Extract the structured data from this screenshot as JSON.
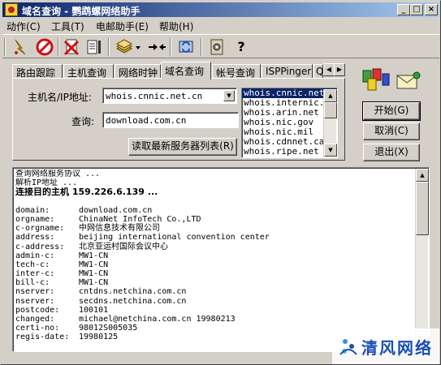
{
  "window": {
    "title": "域名查询 - 鹦鹉螺网络助手",
    "controls": [
      "_",
      "□",
      "×"
    ]
  },
  "menu": [
    {
      "label": "动作(C)"
    },
    {
      "label": "工具(T)"
    },
    {
      "label": "电邮助手(E)"
    },
    {
      "label": "帮助(H)"
    }
  ],
  "toolbar": {
    "icons": [
      "lightning-icon",
      "stop-icon",
      "delete-icon",
      "export-icon",
      "database-icon",
      "dropdown-arrow-icon",
      "connect-icon",
      "refresh-icon",
      "settings-icon",
      "help-icon"
    ],
    "help_label": "?"
  },
  "tabs": [
    {
      "label": "路由跟踪",
      "active": false
    },
    {
      "label": "主机查询",
      "active": false
    },
    {
      "label": "网络时钟",
      "active": false
    },
    {
      "label": "域名查询",
      "active": true
    },
    {
      "label": "帐号查询",
      "active": false
    },
    {
      "label": "ISPPinger",
      "active": false
    },
    {
      "label": "Q",
      "active": false
    }
  ],
  "form": {
    "host_label": "主机名/IP地址:",
    "host_value": "whois.cnnic.net.cn",
    "query_label": "查询:",
    "query_value": "download.com.cn",
    "read_servers_button": "读取最新服务器列表(R)"
  },
  "server_list": {
    "items": [
      "whois.cnnic.net",
      "whois.internic.n",
      "whois.arin.net",
      "whois.nic.gov",
      "whois.nic.mil",
      "whois.cdnnet.ca",
      "whois.ripe.net"
    ],
    "selected_index": 0
  },
  "buttons": {
    "start": "开始(G)",
    "cancel": "取消(C)",
    "exit": "退出(X)"
  },
  "output": {
    "status_lines": [
      {
        "text": "查询网络服务协议 ...",
        "bold": false
      },
      {
        "text": "解析IP地址 ...",
        "bold": false
      },
      {
        "text": "连接目的主机 159.226.6.139 ...",
        "bold": true
      }
    ],
    "records": [
      {
        "key": "domain:",
        "value": "download.com.cn"
      },
      {
        "key": "orgname:",
        "value": "ChinaNet InfoTech Co.,LTD"
      },
      {
        "key": "c-orgname:",
        "value": "中网信息技术有限公司"
      },
      {
        "key": "address:",
        "value": "beijing international convention center"
      },
      {
        "key": "c-address:",
        "value": "北京亚运村国际会议中心"
      },
      {
        "key": "admin-c:",
        "value": "MW1-CN"
      },
      {
        "key": "tech-c:",
        "value": "MW1-CN"
      },
      {
        "key": "inter-c:",
        "value": "MW1-CN"
      },
      {
        "key": "bill-c:",
        "value": "MW1-CN"
      },
      {
        "key": "nserver:",
        "value": "cntdns.netchina.com.cn"
      },
      {
        "key": "nserver:",
        "value": "secdns.netchina.com.cn"
      },
      {
        "key": "postcode:",
        "value": "100101"
      },
      {
        "key": "changed:",
        "value": "michael@netchina.com.cn 19980213"
      },
      {
        "key": "certi-no:",
        "value": "98012S005035"
      },
      {
        "key": "regis-date:",
        "value": "19980125"
      }
    ]
  },
  "watermark": {
    "text": "清风网络"
  },
  "colors": {
    "title_start": "#0a246a",
    "title_end": "#a6caf0",
    "selection": "#0a246a",
    "face": "#d4d0c8"
  }
}
